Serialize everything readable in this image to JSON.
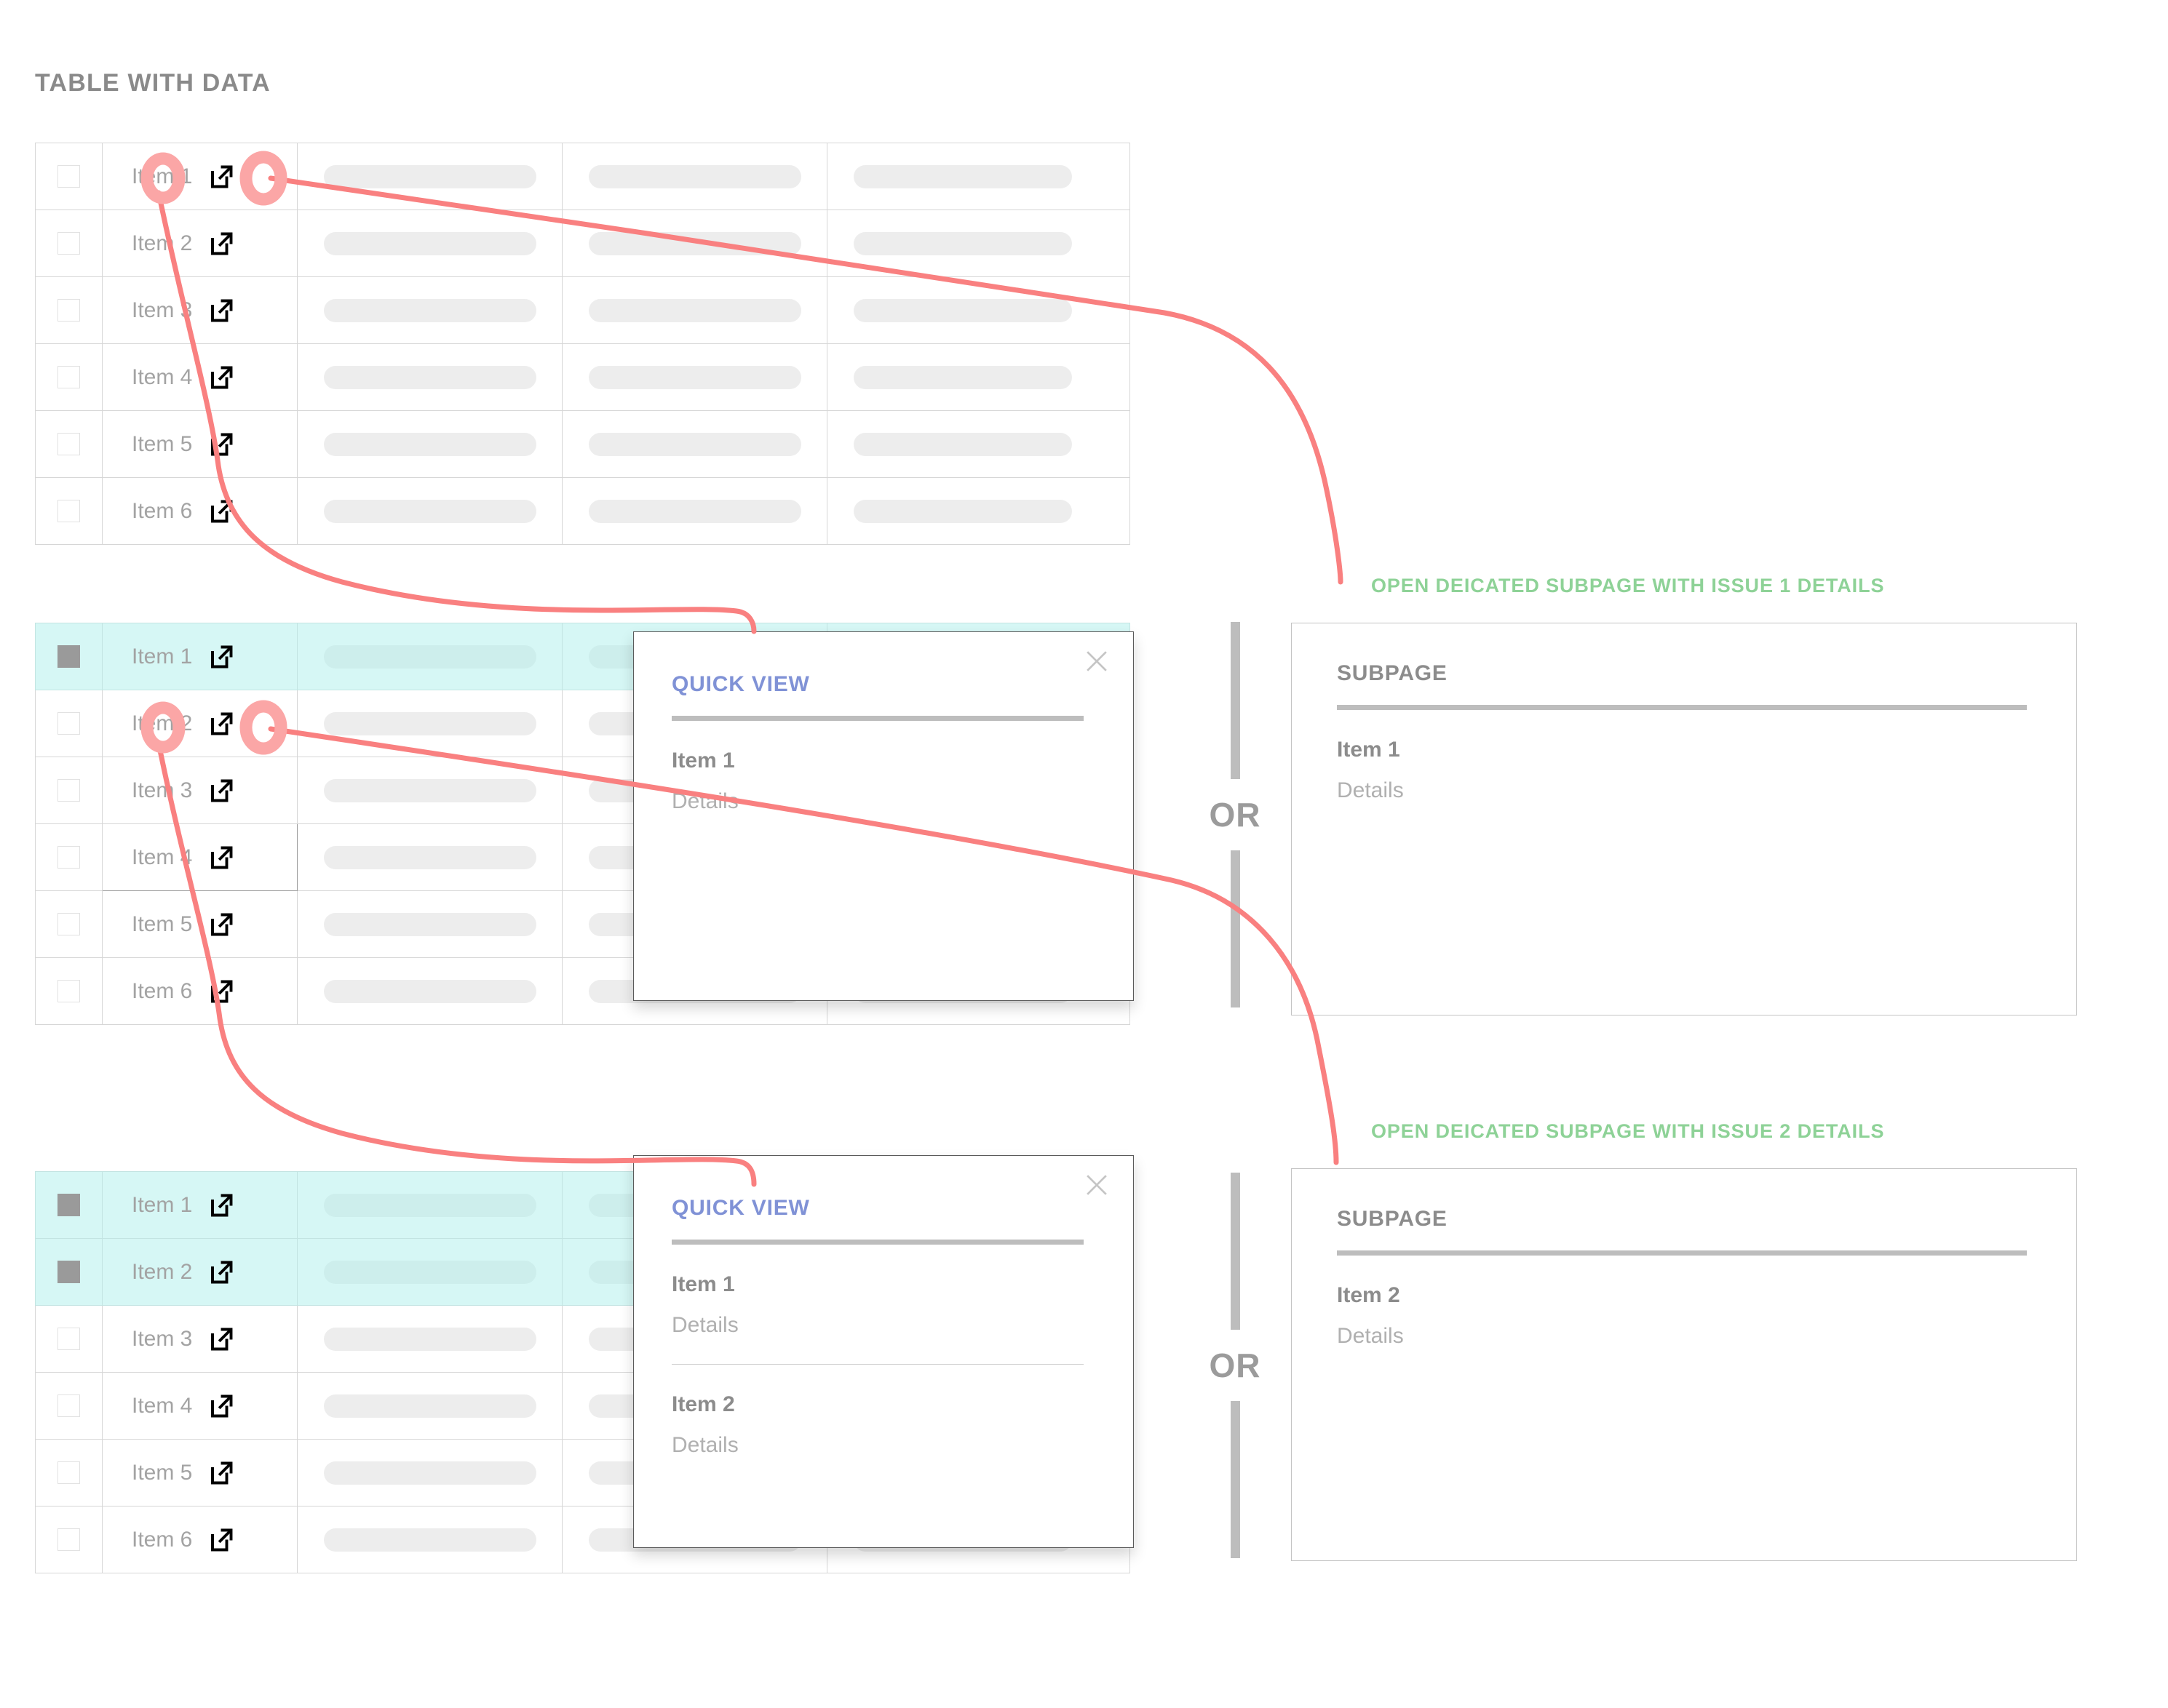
{
  "page": {
    "title": "TABLE WITH DATA"
  },
  "icons": {
    "external_link": "external-link-icon",
    "close": "close-icon",
    "checkbox": "checkbox-icon"
  },
  "colors": {
    "annotation_red": "#f98080",
    "annotation_green": "#8ed297",
    "quickview_accent": "#8092d6",
    "selected_row": "#d6f7f5",
    "muted_text": "#a3a3a3",
    "heading_gray": "#8a8a8a",
    "placeholder_bar": "#ededed"
  },
  "tables": [
    {
      "id": "table-plain",
      "rows": [
        {
          "label": "Item 1",
          "selected": false,
          "checked": false,
          "hovered": false
        },
        {
          "label": "Item 2",
          "selected": false,
          "checked": false,
          "hovered": false
        },
        {
          "label": "Item 3",
          "selected": false,
          "checked": false,
          "hovered": false
        },
        {
          "label": "Item 4",
          "selected": false,
          "checked": false,
          "hovered": false
        },
        {
          "label": "Item 5",
          "selected": false,
          "checked": false,
          "hovered": false
        },
        {
          "label": "Item 6",
          "selected": false,
          "checked": false,
          "hovered": false
        }
      ]
    },
    {
      "id": "table-one-selected",
      "rows": [
        {
          "label": "Item 1",
          "selected": true,
          "checked": true,
          "hovered": false
        },
        {
          "label": "Item 2",
          "selected": false,
          "checked": false,
          "hovered": false
        },
        {
          "label": "Item 3",
          "selected": false,
          "checked": false,
          "hovered": false
        },
        {
          "label": "Item 4",
          "selected": false,
          "checked": false,
          "hovered": true
        },
        {
          "label": "Item 5",
          "selected": false,
          "checked": false,
          "hovered": false
        },
        {
          "label": "Item 6",
          "selected": false,
          "checked": false,
          "hovered": false
        }
      ]
    },
    {
      "id": "table-two-selected",
      "rows": [
        {
          "label": "Item 1",
          "selected": true,
          "checked": true,
          "hovered": false
        },
        {
          "label": "Item 2",
          "selected": true,
          "checked": true,
          "hovered": false
        },
        {
          "label": "Item 3",
          "selected": false,
          "checked": false,
          "hovered": false
        },
        {
          "label": "Item 4",
          "selected": false,
          "checked": false,
          "hovered": false
        },
        {
          "label": "Item 5",
          "selected": false,
          "checked": false,
          "hovered": false
        },
        {
          "label": "Item 6",
          "selected": false,
          "checked": false,
          "hovered": false
        }
      ]
    }
  ],
  "quickviews": [
    {
      "id": "quickview-single",
      "title": "QUICK VIEW",
      "entries": [
        {
          "title": "Item 1",
          "details": "Details"
        }
      ]
    },
    {
      "id": "quickview-double",
      "title": "QUICK VIEW",
      "entries": [
        {
          "title": "Item 1",
          "details": "Details"
        },
        {
          "title": "Item 2",
          "details": "Details"
        }
      ]
    }
  ],
  "or_dividers": [
    {
      "id": "or-top",
      "label": "OR"
    },
    {
      "id": "or-bottom",
      "label": "OR"
    }
  ],
  "subpages": [
    {
      "id": "subpage-issue-1",
      "caption": "OPEN DEICATED SUBPAGE WITH ISSUE 1 DETAILS",
      "title": "SUBPAGE",
      "entry": {
        "title": "Item 1",
        "details": "Details"
      }
    },
    {
      "id": "subpage-issue-2",
      "caption": "OPEN DEICATED SUBPAGE WITH ISSUE 2 DETAILS",
      "title": "SUBPAGE",
      "entry": {
        "title": "Item 2",
        "details": "Details"
      }
    }
  ]
}
